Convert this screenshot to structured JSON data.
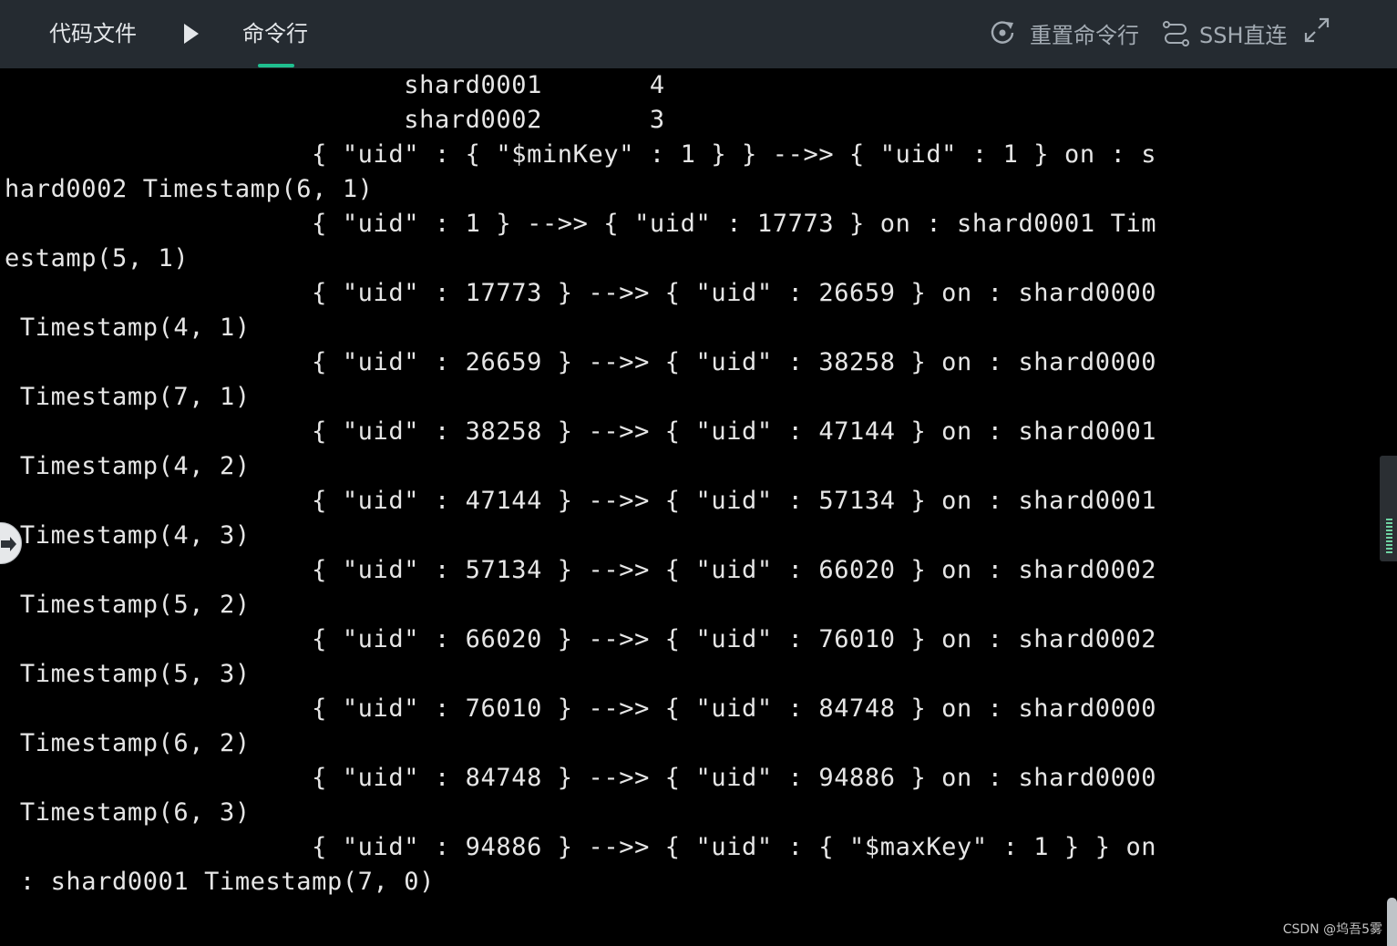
{
  "toolbar": {
    "tab_code": "代码文件",
    "tab_cmd": "命令行",
    "restart_label": "重置命令行",
    "ssh_label": "SSH直连",
    "accent_color": "#1fbf8f"
  },
  "icons": {
    "play": "play-icon",
    "restart": "refresh-icon",
    "ssh": "ssh-connect-icon",
    "expand": "expand-icon",
    "float": "swap-arrow-icon"
  },
  "terminal": {
    "lines": [
      "                          shard0001       4",
      "                          shard0002       3",
      "                    { \"uid\" : { \"$minKey\" : 1 } } -->> { \"uid\" : 1 } on : s",
      "hard0002 Timestamp(6, 1)",
      "                    { \"uid\" : 1 } -->> { \"uid\" : 17773 } on : shard0001 Tim",
      "estamp(5, 1)",
      "                    { \"uid\" : 17773 } -->> { \"uid\" : 26659 } on : shard0000",
      " Timestamp(4, 1)",
      "                    { \"uid\" : 26659 } -->> { \"uid\" : 38258 } on : shard0000",
      " Timestamp(7, 1)",
      "                    { \"uid\" : 38258 } -->> { \"uid\" : 47144 } on : shard0001",
      " Timestamp(4, 2)",
      "                    { \"uid\" : 47144 } -->> { \"uid\" : 57134 } on : shard0001",
      " Timestamp(4, 3)",
      "                    { \"uid\" : 57134 } -->> { \"uid\" : 66020 } on : shard0002",
      " Timestamp(5, 2)",
      "                    { \"uid\" : 66020 } -->> { \"uid\" : 76010 } on : shard0002",
      " Timestamp(5, 3)",
      "                    { \"uid\" : 76010 } -->> { \"uid\" : 84748 } on : shard0000",
      " Timestamp(6, 2)",
      "                    { \"uid\" : 84748 } -->> { \"uid\" : 94886 } on : shard0000",
      " Timestamp(6, 3)",
      "                    { \"uid\" : 94886 } -->> { \"uid\" : { \"$maxKey\" : 1 } } on",
      " : shard0001 Timestamp(7, 0)"
    ]
  },
  "watermark": "CSDN @坞吾5雾"
}
